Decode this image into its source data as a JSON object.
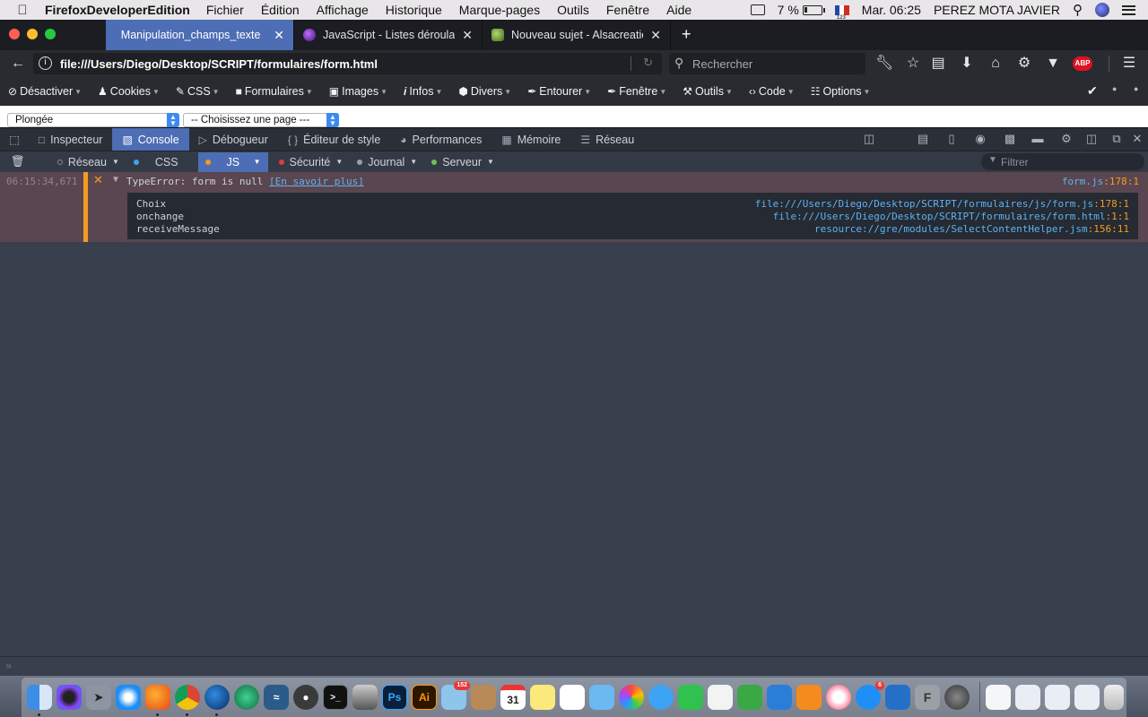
{
  "menubar": {
    "app_name": "FirefoxDeveloperEdition",
    "items": [
      "Fichier",
      "Édition",
      "Affichage",
      "Historique",
      "Marque-pages",
      "Outils",
      "Fenêtre",
      "Aide"
    ],
    "battery": "7 %",
    "keyboard_layout": "123",
    "clock": "Mar. 06:25",
    "user": "PEREZ MOTA JAVIER"
  },
  "tabs": [
    {
      "label": "Manipulation_champs_texte",
      "selected": true
    },
    {
      "label": "JavaScript - Listes déroulante",
      "selected": false
    },
    {
      "label": "Nouveau sujet - Alsacreations",
      "selected": false
    }
  ],
  "navbar": {
    "url": "file:///Users/Diego/Desktop/SCRIPT/formulaires/form.html",
    "search_placeholder": "Rechercher",
    "adblock_label": "ABP"
  },
  "webdev_toolbar": {
    "items": [
      "Désactiver",
      "Cookies",
      "CSS",
      "Formulaires",
      "Images",
      "Infos",
      "Divers",
      "Entourer",
      "Fenêtre",
      "Outils",
      "Code",
      "Options"
    ]
  },
  "page": {
    "select1_value": "Plongée",
    "select2_value": "-- Choisissez une page ---"
  },
  "devtools": {
    "tabs": [
      "Inspecteur",
      "Console",
      "Débogueur",
      "Éditeur de style",
      "Performances",
      "Mémoire",
      "Réseau"
    ],
    "selected_tab": "Console",
    "filters": [
      {
        "label": "Réseau",
        "color": "#1e1e1e"
      },
      {
        "label": "CSS",
        "color": "#3ba6f0"
      },
      {
        "label": "JS",
        "color": "#f49b21"
      },
      {
        "label": "Sécurité",
        "color": "#e23a3a"
      },
      {
        "label": "Journal",
        "color": "#9aa0a6"
      },
      {
        "label": "Serveur",
        "color": "#70bf53"
      }
    ],
    "filter_placeholder": "Filtrer"
  },
  "console": {
    "message": {
      "timestamp": "06:15:34,671",
      "text": "TypeError: form is null",
      "learn_more": "[En savoir plus]",
      "location_file": "form.js",
      "location_line": ":178:1"
    },
    "stack": [
      {
        "fn": "Choix",
        "file": "file:///Users/Diego/Desktop/SCRIPT/formulaires/js/form.js",
        "pos": ":178:1"
      },
      {
        "fn": "onchange",
        "file": "file:///Users/Diego/Desktop/SCRIPT/formulaires/form.html",
        "pos": ":1:1"
      },
      {
        "fn": "receiveMessage",
        "file": "resource://gre/modules/SelectContentHelper.jsm",
        "pos": ":156:11"
      }
    ],
    "prompt": "»"
  },
  "dock": {
    "calendar_day": "31",
    "mail_badge": "152",
    "appstore_badge": "6",
    "ps_label": "Ps",
    "ai_label": "Ai"
  },
  "colors": {
    "accent": "#4d6db5",
    "devtools_bg": "#393f4c",
    "error_bg": "#5a4650",
    "error_marker": "#f49b21",
    "link": "#5eb3f1"
  }
}
